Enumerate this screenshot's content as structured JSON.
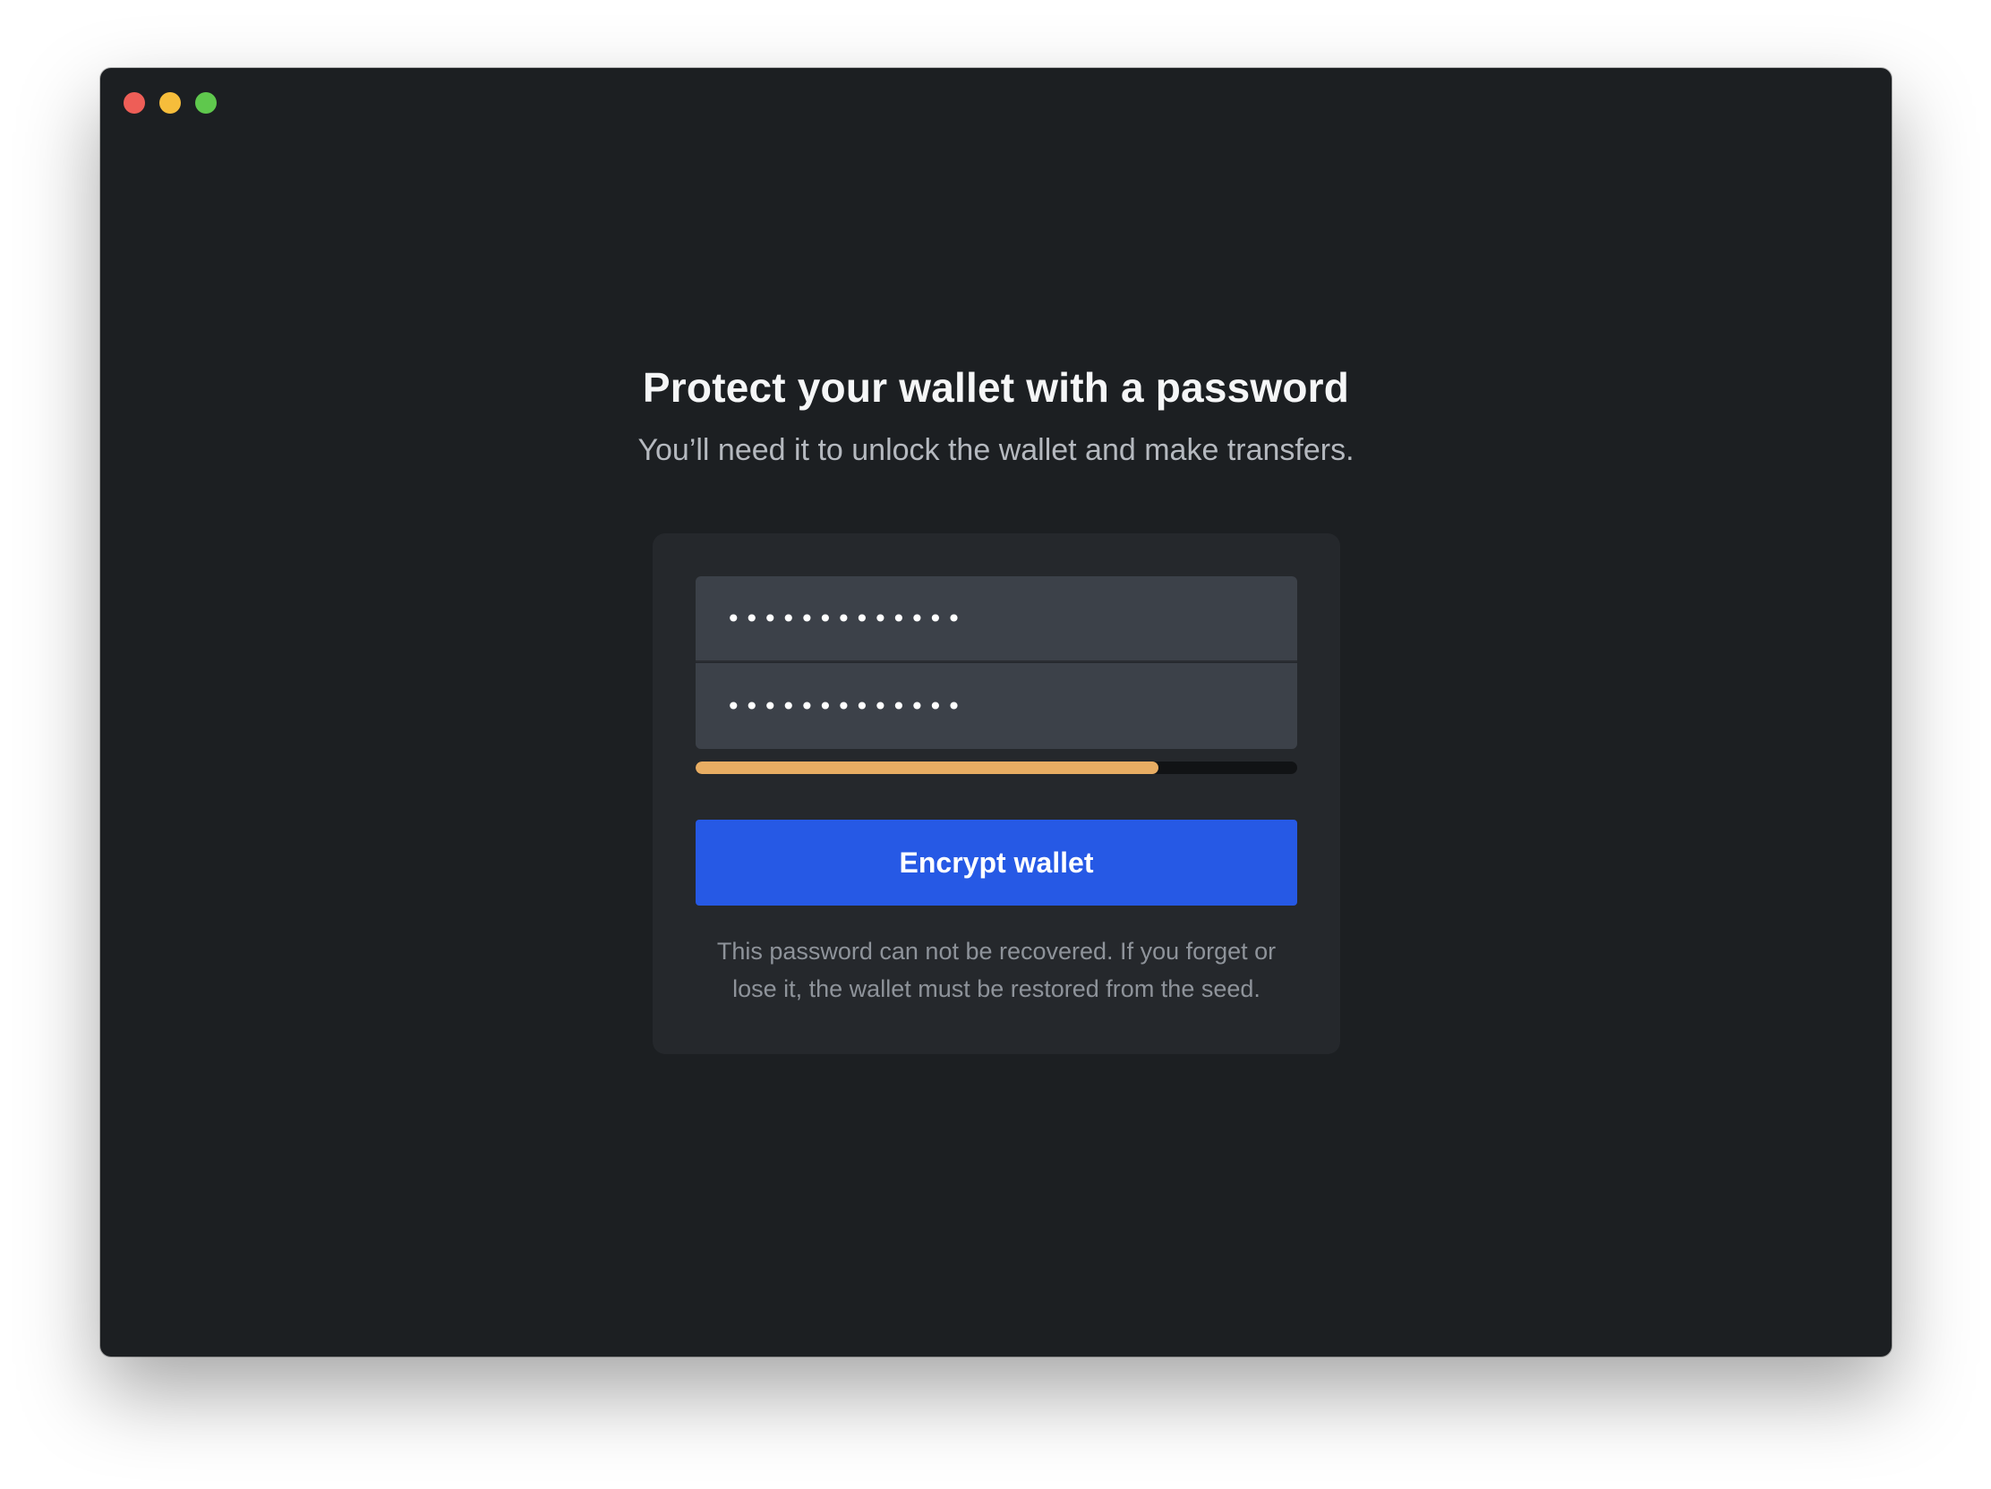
{
  "window": {
    "controls": {
      "close_color": "#ee5e57",
      "minimize_color": "#f6bd3b",
      "maximize_color": "#5fc84d"
    }
  },
  "main": {
    "title": "Protect your wallet with a password",
    "subtitle": "You’ll need it to unlock the wallet and make transfers."
  },
  "form": {
    "password_value": "•••••••••••••",
    "confirm_value": "•••••••••••••",
    "strength": {
      "level_percent": 77,
      "color": "#e8ad63"
    },
    "submit_label": "Encrypt wallet",
    "submit_color": "#2659e5",
    "note_line1": "This password can not be recovered. If you forget or",
    "note_line2": "lose it, the wallet must be restored from the seed."
  }
}
